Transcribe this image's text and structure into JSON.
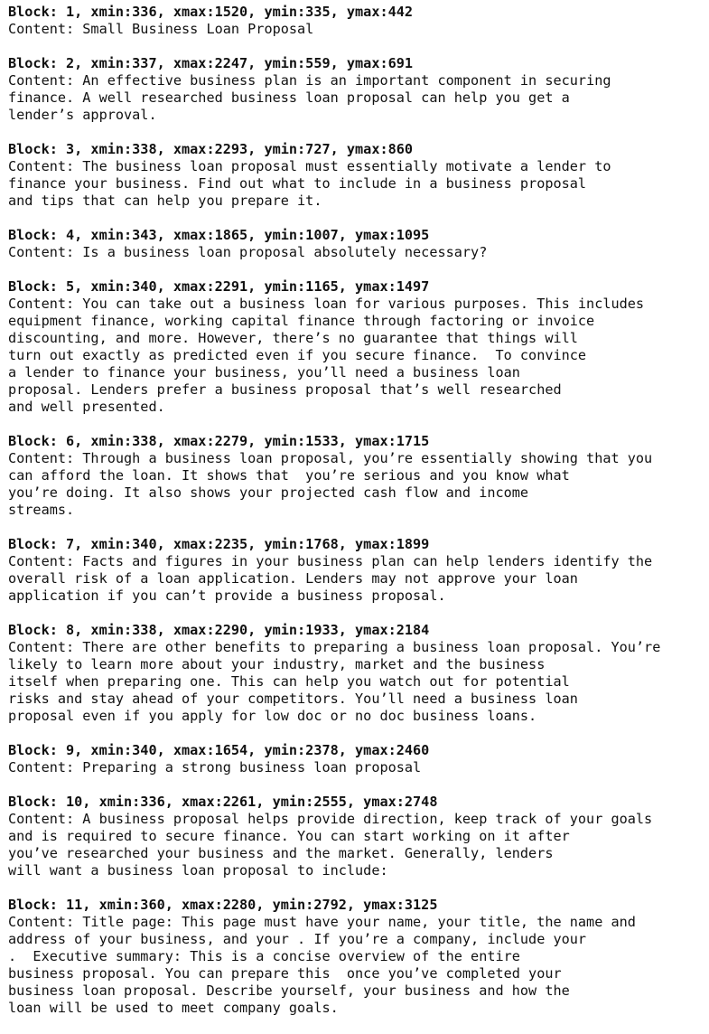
{
  "blocks": [
    {
      "header": "Block: 1, xmin:336, xmax:1520, ymin:335, ymax:442",
      "content": "Content: Small Business Loan Proposal"
    },
    {
      "header": "Block: 2, xmin:337, xmax:2247, ymin:559, ymax:691",
      "content": "Content: An effective business plan is an important component in securing\nfinance. A well researched business loan proposal can help you get a\nlender’s approval."
    },
    {
      "header": "Block: 3, xmin:338, xmax:2293, ymin:727, ymax:860",
      "content": "Content: The business loan proposal must essentially motivate a lender to\nfinance your business. Find out what to include in a business proposal\nand tips that can help you prepare it."
    },
    {
      "header": "Block: 4, xmin:343, xmax:1865, ymin:1007, ymax:1095",
      "content": "Content: Is a business loan proposal absolutely necessary?"
    },
    {
      "header": "Block: 5, xmin:340, xmax:2291, ymin:1165, ymax:1497",
      "content": "Content: You can take out a business loan for various purposes. This includes\nequipment finance, working capital finance through factoring or invoice\ndiscounting, and more. However, there’s no guarantee that things will\nturn out exactly as predicted even if you secure finance.  To convince\na lender to finance your business, you’ll need a business loan\nproposal. Lenders prefer a business proposal that’s well researched\nand well presented."
    },
    {
      "header": "Block: 6, xmin:338, xmax:2279, ymin:1533, ymax:1715",
      "content": "Content: Through a business loan proposal, you’re essentially showing that you\ncan afford the loan. It shows that  you’re serious and you know what\nyou’re doing. It also shows your projected cash flow and income\nstreams."
    },
    {
      "header": "Block: 7, xmin:340, xmax:2235, ymin:1768, ymax:1899",
      "content": "Content: Facts and figures in your business plan can help lenders identify the\noverall risk of a loan application. Lenders may not approve your loan\napplication if you can’t provide a business proposal."
    },
    {
      "header": "Block: 8, xmin:338, xmax:2290, ymin:1933, ymax:2184",
      "content": "Content: There are other benefits to preparing a business loan proposal. You’re\nlikely to learn more about your industry, market and the business\nitself when preparing one. This can help you watch out for potential\nrisks and stay ahead of your competitors. You’ll need a business loan\nproposal even if you apply for low doc or no doc business loans."
    },
    {
      "header": "Block: 9, xmin:340, xmax:1654, ymin:2378, ymax:2460",
      "content": "Content: Preparing a strong business loan proposal"
    },
    {
      "header": "Block: 10, xmin:336, xmax:2261, ymin:2555, ymax:2748",
      "content": "Content: A business proposal helps provide direction, keep track of your goals\nand is required to secure finance. You can start working on it after\nyou’ve researched your business and the market. Generally, lenders\nwill want a business loan proposal to include:"
    },
    {
      "header": "Block: 11, xmin:360, xmax:2280, ymin:2792, ymax:3125",
      "content": "Content: Title page: This page must have your name, your title, the name and\naddress of your business, and your . If you’re a company, include your\n.  Executive summary: This is a concise overview of the entire\nbusiness proposal. You can prepare this  once you’ve completed your\nbusiness loan proposal. Describe yourself, your business and how the\nloan will be used to meet company goals."
    }
  ]
}
